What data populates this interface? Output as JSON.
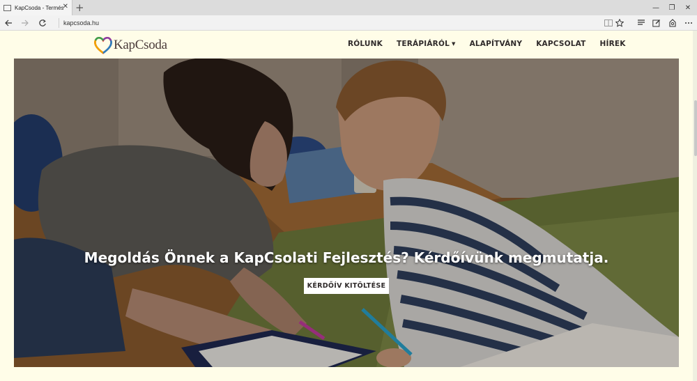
{
  "browser": {
    "tab_title": "KapCsoda - Természete",
    "tab_close": "✕",
    "new_tab": "+",
    "url": "kapcsoda.hu",
    "window_controls": [
      "—",
      "❐",
      "✕"
    ]
  },
  "site": {
    "logo_text": "KapCsoda",
    "menu": [
      {
        "label": "RÓLUNK",
        "has_dropdown": false
      },
      {
        "label": "TERÁPIÁRÓL",
        "has_dropdown": true
      },
      {
        "label": "ALAPÍTVÁNY",
        "has_dropdown": false
      },
      {
        "label": "KAPCSOLAT",
        "has_dropdown": false
      },
      {
        "label": "HÍREK",
        "has_dropdown": false
      }
    ]
  },
  "hero": {
    "title": "Megoldás Önnek a KapCsolati Fejlesztés? Kérdőívünk megmutatja.",
    "button": "KÉRDŐÍV KITÖLTÉSE"
  },
  "colors": {
    "page_bg": "#fffde8",
    "text_dark": "#2f2a2a",
    "button_bg": "#ffffff"
  }
}
